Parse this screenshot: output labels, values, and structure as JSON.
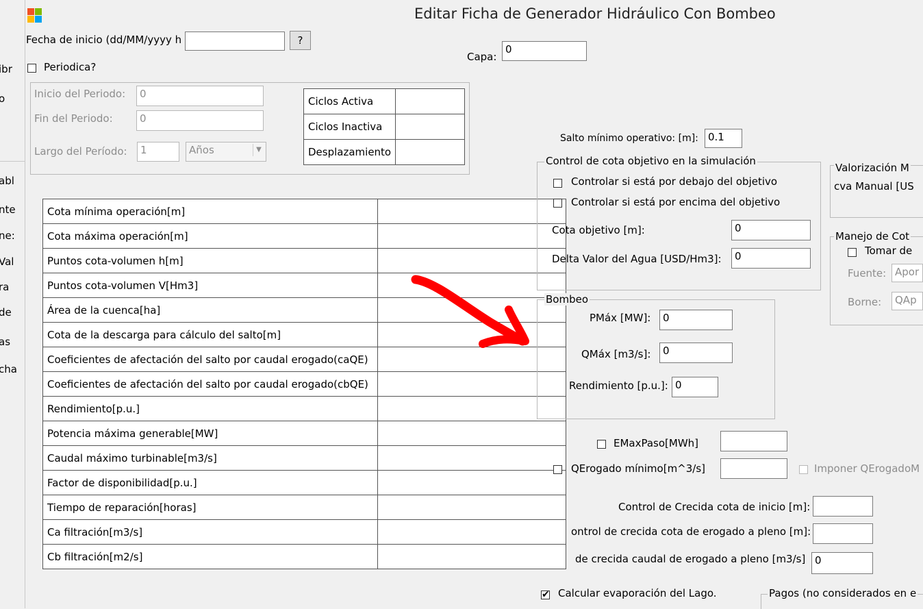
{
  "window": {
    "title": "Editar Ficha de Generador Hidráulico Con Bombeo"
  },
  "left_fragments": [
    "ibr",
    "o",
    "abl",
    "nte",
    "ne:",
    "Val",
    "ra",
    "de",
    "as",
    "cha"
  ],
  "top": {
    "fecha_label": "Fecha de inicio (dd/MM/yyyy h",
    "fecha_value": "",
    "help_button": "?",
    "capa_label": "Capa:",
    "capa_value": "0",
    "periodica_label": "Periodica?"
  },
  "periodo": {
    "inicio_label": "Inicio del Periodo:",
    "inicio_value": "0",
    "fin_label": "Fin del Periodo:",
    "fin_value": "0",
    "largo_label": "Largo del Período:",
    "largo_value": "1",
    "unidad_value": "Años",
    "ciclos": [
      {
        "label": "Ciclos Activa",
        "value": ""
      },
      {
        "label": "Ciclos Inactiva",
        "value": ""
      },
      {
        "label": "Desplazamiento",
        "value": ""
      }
    ]
  },
  "params_table": {
    "rows": [
      "Cota mínima operación[m]",
      "Cota máxima operación[m]",
      "Puntos cota-volumen h[m]",
      "Puntos cota-volumen V[Hm3]",
      "Área de la cuenca[ha]",
      "Cota de la descarga para cálculo del salto[m]",
      "Coeficientes de afectación del salto por caudal erogado(caQE)",
      "Coeficientes de afectación del salto por caudal erogado(cbQE)",
      "Rendimiento[p.u.]",
      "Potencia máxima generable[MW]",
      "Caudal máximo turbinable[m3/s]",
      "Factor de disponibilidad[p.u.]",
      "Tiempo de reparación[horas]",
      "Ca filtración[m3/s]",
      "Cb filtración[m2/s]"
    ]
  },
  "salto": {
    "label": "Salto mínimo operativo: [m]:",
    "value": "0.1"
  },
  "control_cota": {
    "title": "Control de cota objetivo en la simulación",
    "debajo_label": "Controlar si está por debajo del objetivo",
    "encima_label": "Controlar si está por encima del objetivo",
    "cota_obj_label": "Cota objetivo  [m]:",
    "cota_obj_value": "0",
    "delta_label": "Delta Valor del Agua [USD/Hm3]:",
    "delta_value": "0"
  },
  "bombeo": {
    "title": "Bombeo",
    "pmax_label": "PMáx [MW]:",
    "pmax_value": "0",
    "qmax_label": "QMáx [m3/s]:",
    "qmax_value": "0",
    "rend_label": "Rendimiento [p.u.]:",
    "rend_value": "0"
  },
  "valorizacion": {
    "line1": "Valorización M",
    "line2": "cva Manual [US"
  },
  "manejo": {
    "title": "Manejo de Cot",
    "tomar_label": "Tomar de",
    "fuente_label": "Fuente:",
    "fuente_value": "Apor",
    "borne_label": "Borne:",
    "borne_value": "QAp"
  },
  "lower": {
    "emax_label": "EMaxPaso[MWh]",
    "emax_value": "",
    "qerog_label": "QErogado mínimo[m^3/s]",
    "qerog_value": "",
    "imponer_label": "Imponer QErogadoM",
    "crecida_inicio_label": "Control de Crecida cota de inicio [m]:",
    "crecida_inicio_value": "",
    "crecida_pleno_label": "ontrol de crecida cota de erogado a pleno [m]:",
    "crecida_pleno_value": "",
    "crecida_caudal_label": "de crecida caudal de erogado a pleno [m3/s]",
    "crecida_caudal_value": "0",
    "evap_label": "Calcular evaporación del Lago.",
    "pagos_label": "Pagos (no considerados en e"
  },
  "colors": {
    "arrow": "#ff0000",
    "background": "#f0f0f0"
  }
}
